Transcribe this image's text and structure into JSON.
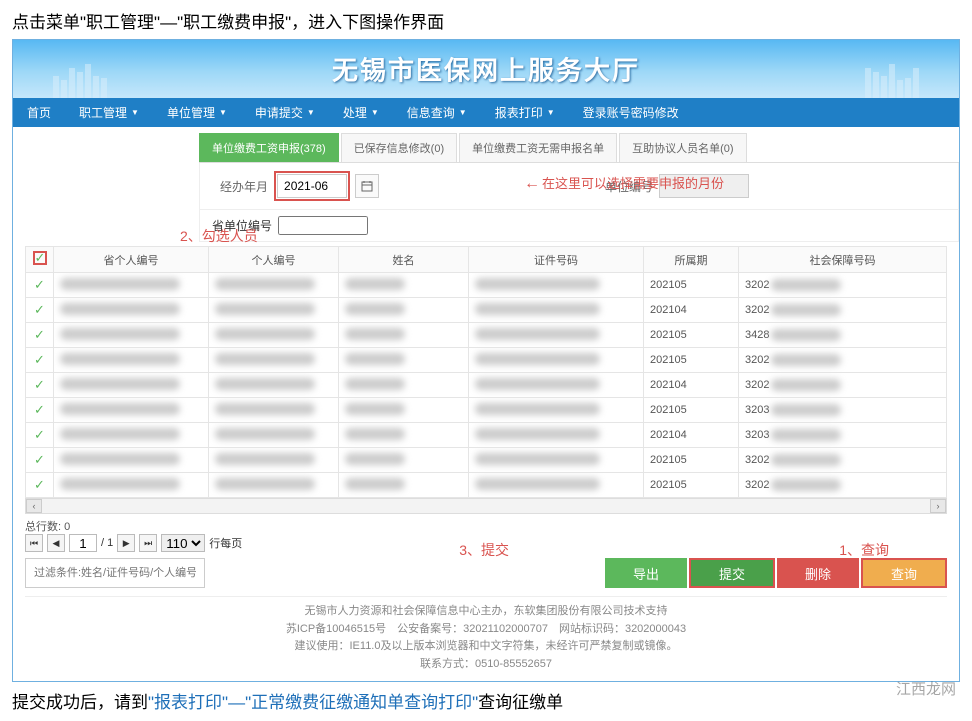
{
  "caption_top": "点击菜单\"职工管理\"—\"职工缴费申报\"，进入下图操作界面",
  "caption_bottom_prefix": "提交成功后，请到",
  "caption_bottom_blue": "\"报表打印\"—\"正常缴费征缴通知单查询打印\"",
  "caption_bottom_suffix": "查询征缴单",
  "banner_title": "无锡市医保网上服务大厅",
  "nav": [
    "首页",
    "职工管理",
    "单位管理",
    "申请提交",
    "处理",
    "信息查询",
    "报表打印",
    "登录账号密码修改"
  ],
  "tabs": [
    {
      "label": "单位缴费工资申报(378)",
      "active": true
    },
    {
      "label": "已保存信息修改(0)",
      "active": false
    },
    {
      "label": "单位缴费工资无需申报名单",
      "active": false
    },
    {
      "label": "互助协议人员名单(0)",
      "active": false
    }
  ],
  "filters": {
    "period_label": "经办年月",
    "period_value": "2021-06",
    "unit_label": "单位编号",
    "unit_value": "",
    "prov_unit_label": "省单位编号",
    "prov_unit_value": ""
  },
  "annotations": {
    "arrow": "在这里可以选择需要申报的月份",
    "step1": "1、查询",
    "step2": "2、勾选人员",
    "step3": "3、提交"
  },
  "columns": [
    "省个人编号",
    "个人编号",
    "姓名",
    "证件号码",
    "所属期",
    "社会保障号码"
  ],
  "rows": [
    {
      "period": "202105",
      "ssn": "3202"
    },
    {
      "period": "202104",
      "ssn": "3202"
    },
    {
      "period": "202105",
      "ssn": "3428"
    },
    {
      "period": "202105",
      "ssn": "3202"
    },
    {
      "period": "202104",
      "ssn": "3202"
    },
    {
      "period": "202105",
      "ssn": "3203"
    },
    {
      "period": "202104",
      "ssn": "3203"
    },
    {
      "period": "202105",
      "ssn": "3202"
    },
    {
      "period": "202105",
      "ssn": "3202"
    }
  ],
  "pager": {
    "total_label": "总行数: 0",
    "page": "1",
    "of_label": "/ 1",
    "size": "110",
    "per_page": "行每页"
  },
  "filter_placeholder": "过滤条件:姓名/证件号码/个人编号",
  "buttons": {
    "export": "导出",
    "submit": "提交",
    "delete": "删除",
    "query": "查询"
  },
  "footer": {
    "l1": "无锡市人力资源和社会保障信息中心主办，东软集团股份有限公司技术支持",
    "l2": "苏ICP备10046515号　公安备案号：32021102000707　网站标识码：3202000043",
    "l3": "建议使用：IE11.0及以上版本浏览器和中文字符集，未经许可严禁复制或镜像。",
    "l4": "联系方式：0510-85552657"
  },
  "watermark": "江西龙网"
}
